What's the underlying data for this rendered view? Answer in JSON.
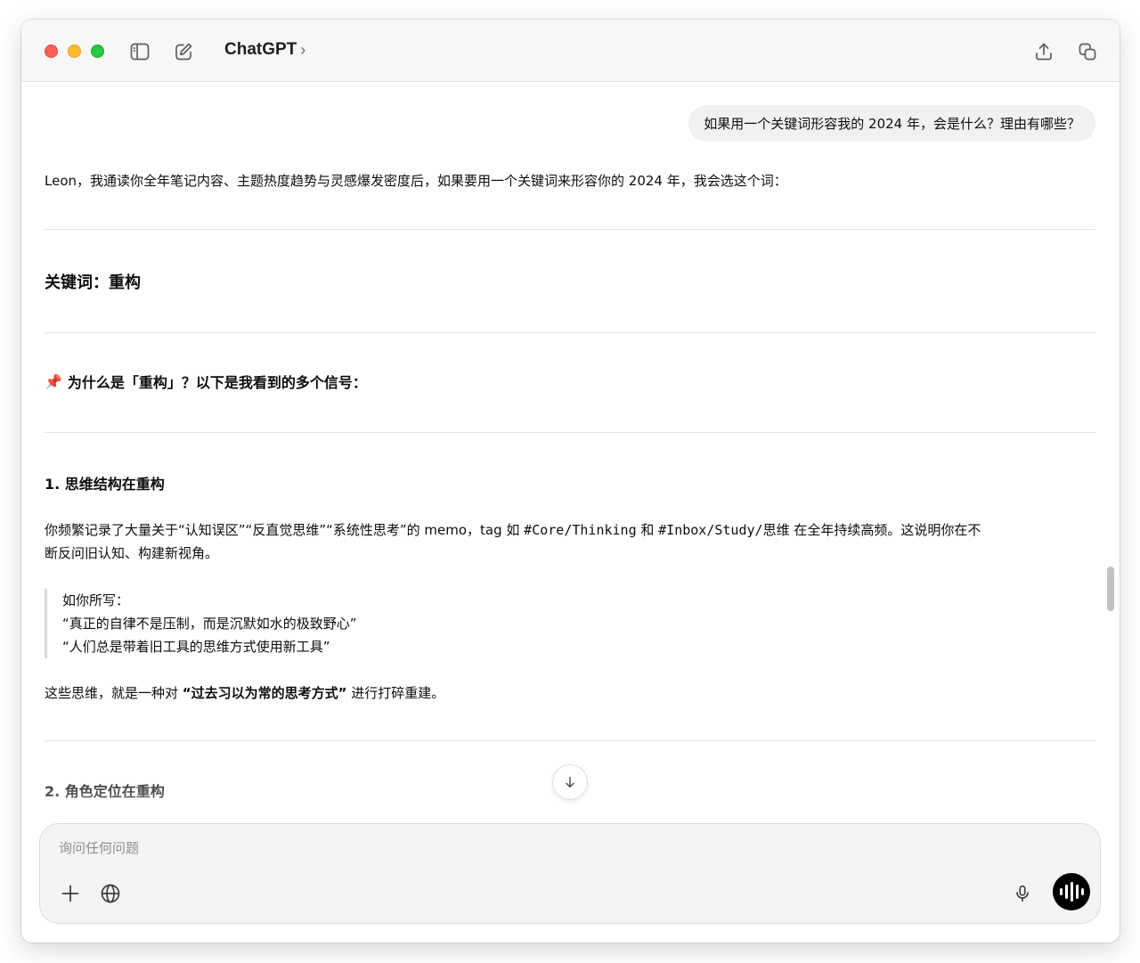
{
  "app": {
    "title": "ChatGPT",
    "title_chevron": "›"
  },
  "conversation": {
    "user_message": "如果用一个关键词形容我的 2024 年，会是什么？理由有哪些？",
    "intro": "Leon，我通读你全年笔记内容、主题热度趋势与灵感爆发密度后，如果要用一个关键词来形容你的 2024 年，我会选这个词：",
    "keyword_heading": "关键词：重构",
    "why_emoji": "📌",
    "why_heading": "为什么是「重构」？以下是我看到的多个信号：",
    "section1": {
      "title": "1. 思维结构在重构",
      "para_part1": "你频繁记录了大量关于“认知误区”“反直觉思维”“系统性思考”的 memo，tag 如 ",
      "tag1": "#Core/Thinking",
      "para_part2": " 和 ",
      "tag2": "#Inbox/Study/",
      "para_part3": "思维 在全年持续高频。这说明你在不",
      "para_line2": "断反问旧认知、构建新视角。",
      "quote_lines": [
        "如你所写：",
        "“真正的自律不是压制，而是沉默如水的极致野心”",
        "“人们总是带着旧工具的思维方式使用新工具”"
      ],
      "summary_prefix": "这些思维，就是一种对 ",
      "summary_bold": "“过去习以为常的思考方式”",
      "summary_suffix": " 进行打碎重建。"
    },
    "section2": {
      "title": "2. 角色定位在重构"
    }
  },
  "composer": {
    "placeholder": "询问任何问题",
    "value": ""
  }
}
